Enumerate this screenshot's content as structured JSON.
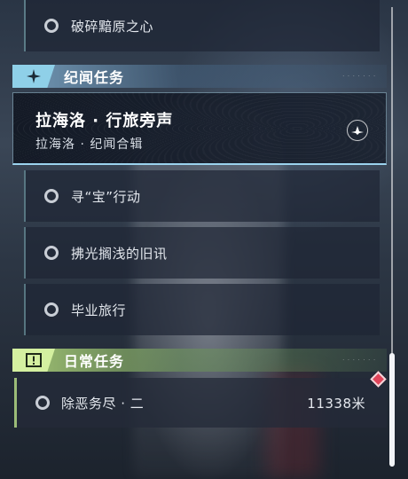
{
  "quests_top": [
    {
      "label": "破碎黯原之心"
    }
  ],
  "lore_section": {
    "title": "纪闻任务",
    "badge_icon": "sparkle-star-icon",
    "color": "#8fd0e8"
  },
  "featured": {
    "title": "拉海洛 · 行旅旁声",
    "subtitle": "拉海洛 · 纪闻合辑",
    "icon": "compass-emblem-icon"
  },
  "lore_quests": [
    {
      "label": "寻“宝”行动"
    },
    {
      "label": "拂光搁浅的旧讯"
    },
    {
      "label": "毕业旅行"
    }
  ],
  "daily_section": {
    "title": "日常任务",
    "badge_icon": "exclamation-box-icon",
    "color": "#d4f0a0"
  },
  "daily_quests": [
    {
      "label": "除恶务尽 · 二",
      "distance": "11338米",
      "tracked": true
    }
  ]
}
